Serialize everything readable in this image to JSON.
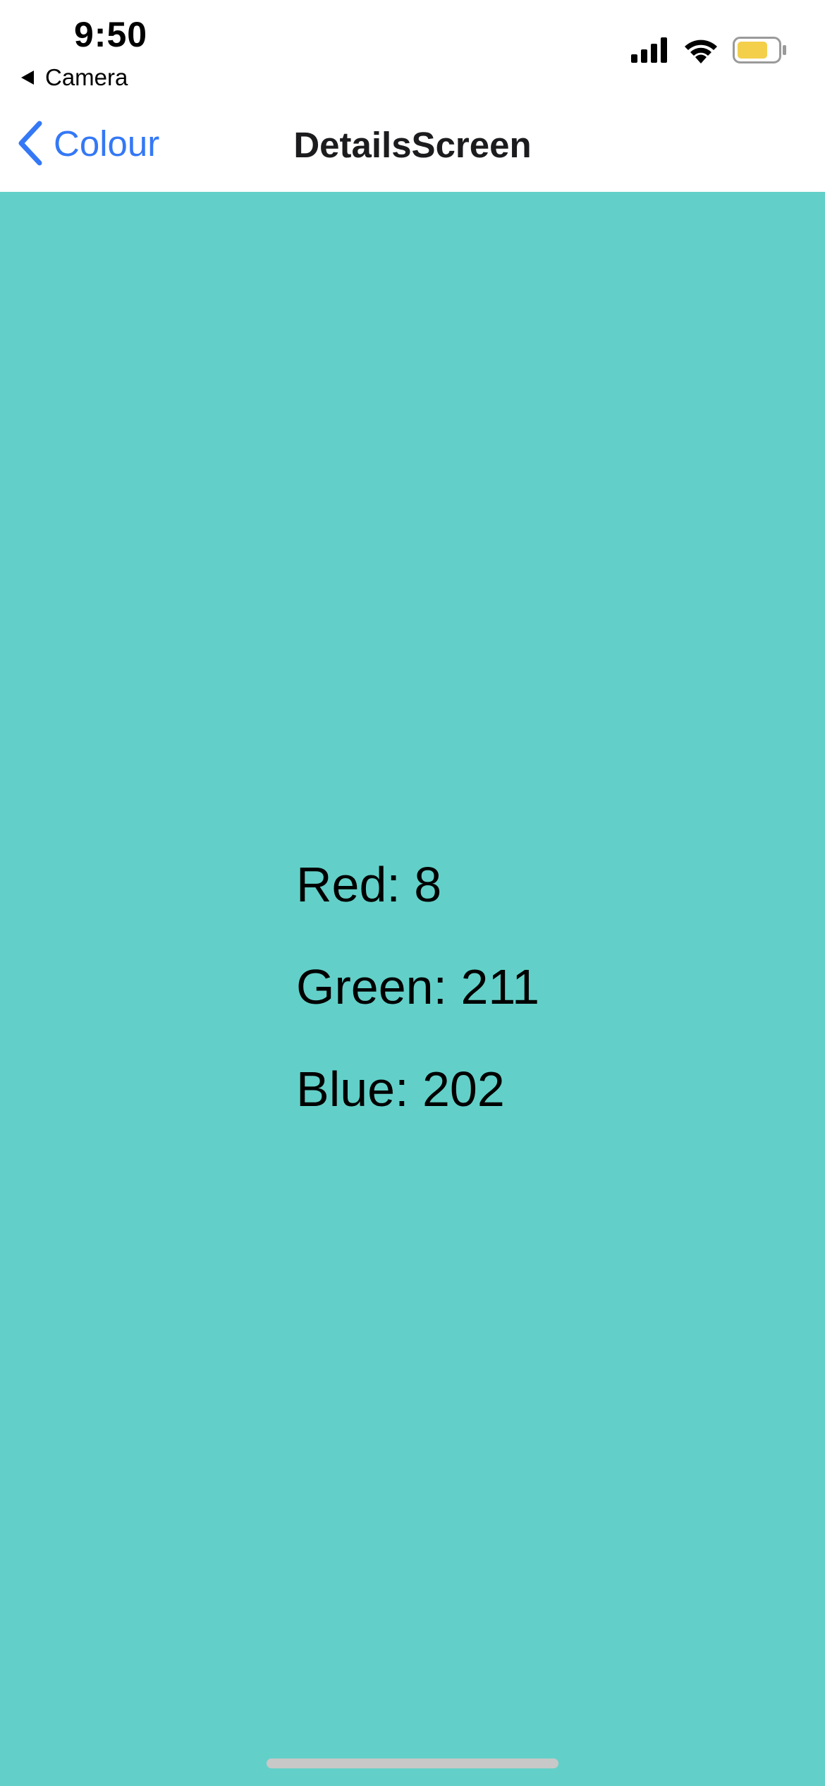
{
  "status_bar": {
    "time": "9:50",
    "back_app_label": "Camera",
    "battery_color": "#f4cf4a"
  },
  "nav": {
    "back_label": "Colour",
    "title": "DetailsScreen",
    "accent_color": "#3478f6"
  },
  "colour": {
    "background": "#62d0c8",
    "lines": [
      {
        "label": "Red: 8"
      },
      {
        "label": "Green: 211"
      },
      {
        "label": "Blue: 202"
      }
    ]
  },
  "icons": {
    "back": "chevron-left-icon",
    "signal": "cellular-signal-icon",
    "wifi": "wifi-icon",
    "battery": "battery-icon",
    "back_app": "triangle-left-icon"
  }
}
